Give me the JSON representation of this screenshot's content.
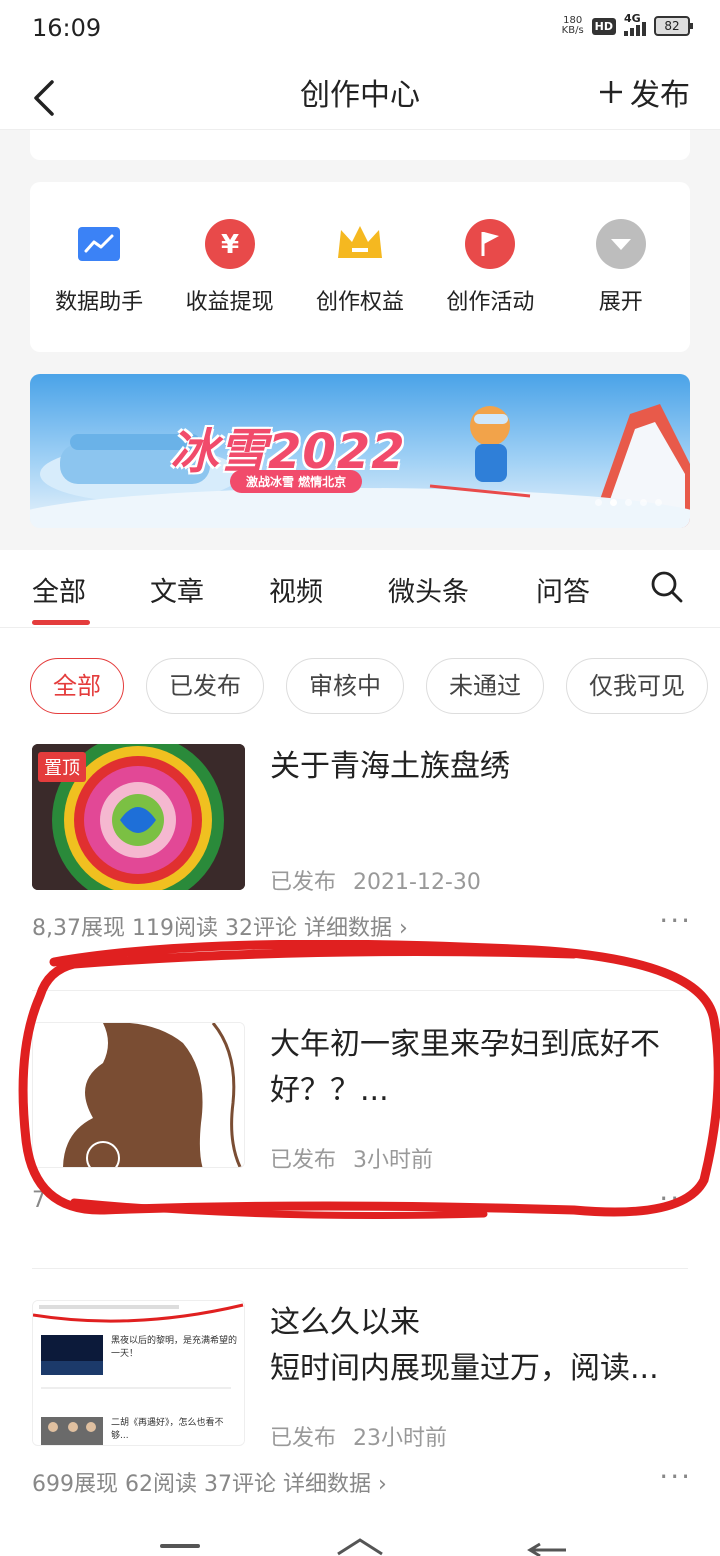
{
  "status_bar": {
    "time": "16:09",
    "net_speed_value": "180",
    "net_speed_unit": "KB/s",
    "hd": "HD",
    "network": "4G",
    "battery": "82"
  },
  "header": {
    "title": "创作中心",
    "publish_label": "发布"
  },
  "tools": [
    {
      "label": "数据助手",
      "icon": "chart-icon",
      "color": "#3b82f6"
    },
    {
      "label": "收益提现",
      "icon": "yuan-icon",
      "color": "#e84a4a"
    },
    {
      "label": "创作权益",
      "icon": "crown-icon",
      "color": "#f5b820"
    },
    {
      "label": "创作活动",
      "icon": "flag-icon",
      "color": "#e84a4a"
    },
    {
      "label": "展开",
      "icon": "chevron-down-icon",
      "color": "#bbbbbb"
    }
  ],
  "banner": {
    "title": "冰雪2022",
    "subtitle": "激战冰雪 燃情北京"
  },
  "tabs": [
    "全部",
    "文章",
    "视频",
    "微头条",
    "问答"
  ],
  "filters": [
    "全部",
    "已发布",
    "审核中",
    "未通过",
    "仅我可见"
  ],
  "articles": [
    {
      "pin": "置顶",
      "title": "关于青海土族盘绣",
      "status": "已发布",
      "time": "2021-12-30",
      "stats": "8,3",
      "stats_rest": "7展现  119阅读  32评论  详细数据 ›"
    },
    {
      "title": "大年初一家里来孕妇到底好不好？？...",
      "status": "已发布",
      "time": "3小时前",
      "stats": "7"
    },
    {
      "title": "这么久以来\n短时间内展现量过万，阅读...",
      "status": "已发布",
      "time": "23小时前",
      "stats": "699展现  62阅读  37评论  详细数据 ›",
      "thumb_line1": "黑夜以后的黎明，是充满希望的一天！",
      "thumb_line2": "二胡《再遇好》，怎么也看不够..."
    }
  ],
  "colors": {
    "accent": "#e43c3c",
    "annotation": "#e02020"
  }
}
